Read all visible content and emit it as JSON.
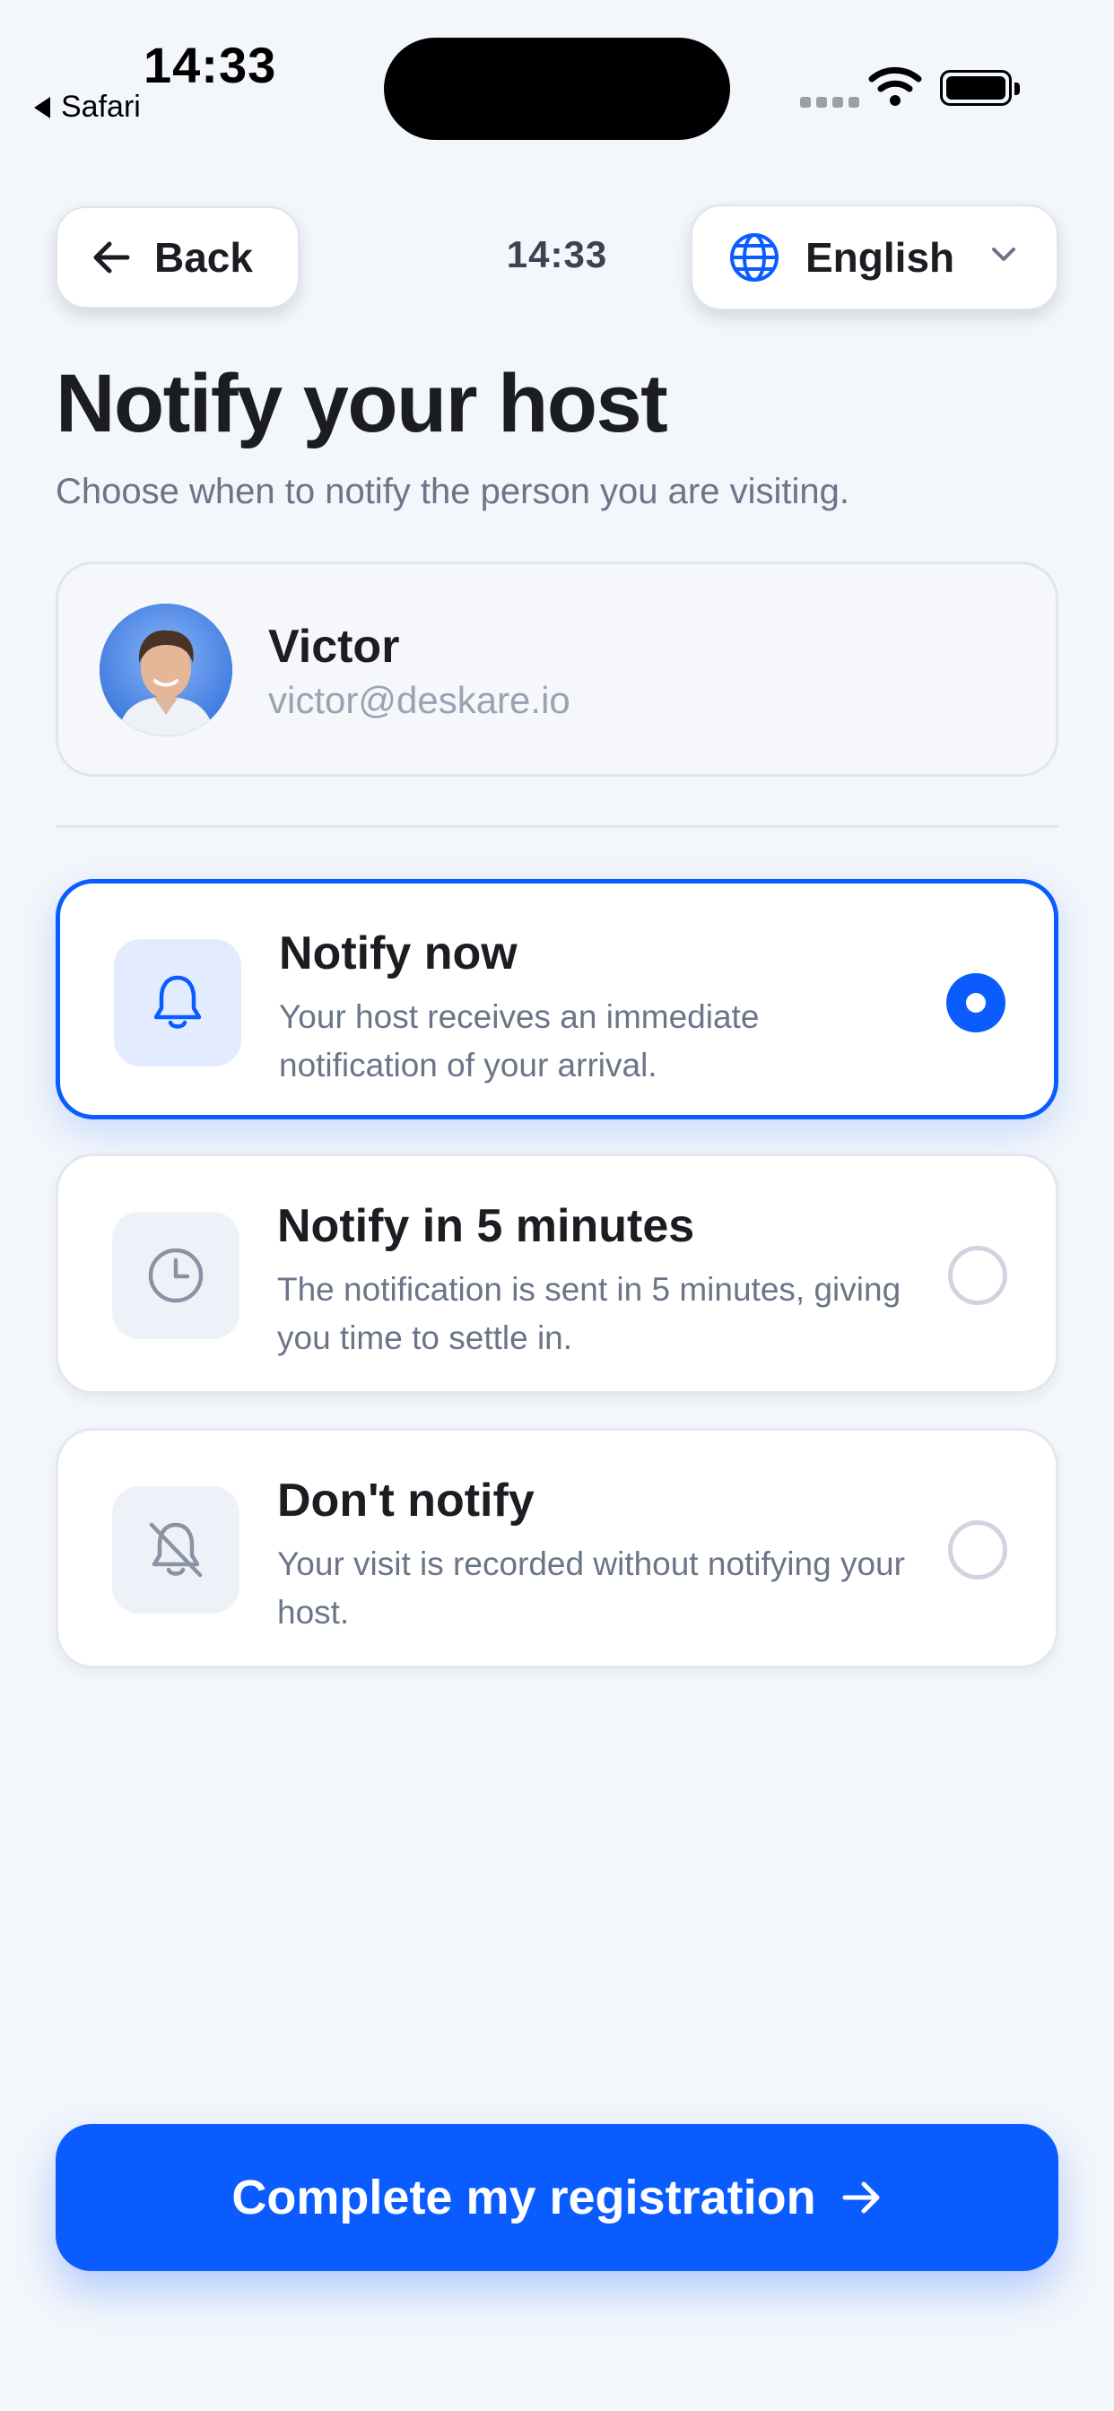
{
  "status_bar": {
    "time": "14:33",
    "back_app": "Safari"
  },
  "header": {
    "back_label": "Back",
    "time": "14:33",
    "language": "English"
  },
  "page": {
    "title": "Notify your host",
    "subtitle": "Choose when to notify the person you are visiting."
  },
  "host": {
    "name": "Victor",
    "email": "victor@deskare.io"
  },
  "options": [
    {
      "title": "Notify now",
      "description": "Your host receives an immediate notification of your arrival.",
      "icon": "bell-icon",
      "selected": true
    },
    {
      "title": "Notify in 5 minutes",
      "description": "The notification is sent in 5 minutes, giving you time to settle in.",
      "icon": "clock-icon",
      "selected": false
    },
    {
      "title": "Don't notify",
      "description": "Your visit is recorded without notifying your host.",
      "icon": "bell-off-icon",
      "selected": false
    }
  ],
  "cta": {
    "label": "Complete my registration"
  },
  "colors": {
    "accent": "#0a5cff",
    "background": "#f3f6fb",
    "text_primary": "#1c1d22",
    "text_secondary": "#6b7588"
  }
}
